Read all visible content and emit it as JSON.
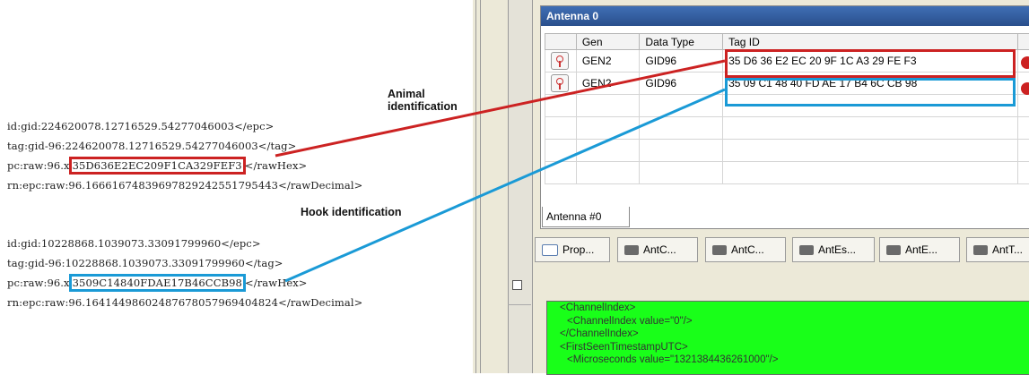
{
  "left": {
    "animal_label": "Animal identification",
    "hook_label": "Hook identification",
    "animal_block": {
      "epc": "id:gid:224620078.12716529.54277046003</epc>",
      "tag": "tag:gid-96:224620078.12716529.54277046003</tag>",
      "pc_prefix": "pc:raw:96.x",
      "pc_hex": "35D636E2EC209F1CA329FEF3",
      "pc_suffix": "</rawHex>",
      "rn": "rn:epc:raw:96.16661674839697829242551795443</rawDecimal>"
    },
    "hook_block": {
      "epc": "id:gid:10228868.1039073.33091799960</epc>",
      "tag": "tag:gid-96:10228868.1039073.33091799960</tag>",
      "pc_prefix": "pc:raw:96.x",
      "pc_hex": "3509C14840FDAE17B46CCB98",
      "pc_suffix": "</rawHex>",
      "rn": "rn:epc:raw:96.16414498602487678057969404824</rawDecimal>"
    }
  },
  "panel": {
    "title": "Antenna 0",
    "columns": [
      "Gen",
      "Data Type",
      "Tag ID"
    ],
    "rows": [
      {
        "gen": "GEN2",
        "type": "GID96",
        "tag": "35 D6 36 E2 EC 20 9F 1C A3 29 FE F3"
      },
      {
        "gen": "GEN2",
        "type": "GID96",
        "tag": "35 09 C1 48 40 FD AE 17 B4 6C CB 98"
      }
    ],
    "bottom_tab": "Antenna #0"
  },
  "view_tabs": [
    "Prop...",
    "AntC...",
    "AntC...",
    "AntEs...",
    "AntE...",
    "AntT..."
  ],
  "console_lines": [
    "<ChannelIndex>",
    "  <ChannelIndex value=\"0\"/>",
    "</ChannelIndex>",
    "<FirstSeenTimestampUTC>",
    "  <Microseconds value=\"1321384436261000\"/>"
  ],
  "colors": {
    "animal": "#cc2222",
    "hook": "#1a9ad6",
    "console_bg": "#19ff19"
  }
}
